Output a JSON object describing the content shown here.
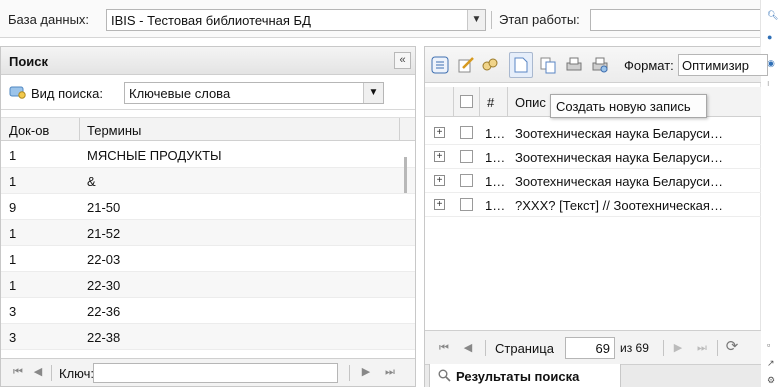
{
  "toolbar": {
    "db_label": "База данных:",
    "db_value": "IBIS - Тестовая библиотечная БД",
    "stage_label": "Этап работы:"
  },
  "left_panel": {
    "title": "Поиск",
    "search_type_label": "Вид поиска:",
    "search_type_value": "Ключевые слова",
    "columns": [
      "Док-ов",
      "Термины"
    ],
    "rows": [
      {
        "count": "1",
        "term": "МЯСНЫЕ ПРОДУКТЫ"
      },
      {
        "count": "1",
        "term": "&"
      },
      {
        "count": "9",
        "term": "21-50"
      },
      {
        "count": "1",
        "term": "21-52"
      },
      {
        "count": "1",
        "term": "22-03"
      },
      {
        "count": "1",
        "term": "22-30"
      },
      {
        "count": "3",
        "term": "22-36"
      },
      {
        "count": "3",
        "term": "22-38"
      }
    ],
    "key_label": "Ключ:"
  },
  "right_panel": {
    "format_label": "Формат:",
    "format_value": "Оптимизир",
    "columns": {
      "num": "#",
      "desc": "Опис"
    },
    "tooltip": "Создать новую запись",
    "rows": [
      {
        "num": "1…",
        "text": "Зоотехническая наука Беларуси…"
      },
      {
        "num": "1…",
        "text": "Зоотехническая наука Беларуси…"
      },
      {
        "num": "1…",
        "text": "Зоотехническая наука Беларуси…"
      },
      {
        "num": "1…",
        "text": "?XXX? [Текст] // Зоотехническая…"
      }
    ],
    "page_label": "Страница",
    "page_value": "69",
    "page_total": "из 69",
    "tab_label": "Результаты поиска"
  },
  "icons": [
    "collapse-panel-icon",
    "search-type-icon",
    "dropdown-arrow-icon",
    "first-page-icon",
    "prev-page-icon",
    "next-page-icon",
    "last-page-icon",
    "list-view-icon",
    "edit-record-icon",
    "find-replace-icon",
    "new-record-icon",
    "copy-icon",
    "print-icon",
    "print-preview-icon",
    "expand-icon",
    "refresh-icon",
    "magnifier-icon"
  ],
  "colors": {
    "accent": "#2f6fb6",
    "panel_header": "#e9e9e9",
    "border": "#c8c8c8"
  }
}
